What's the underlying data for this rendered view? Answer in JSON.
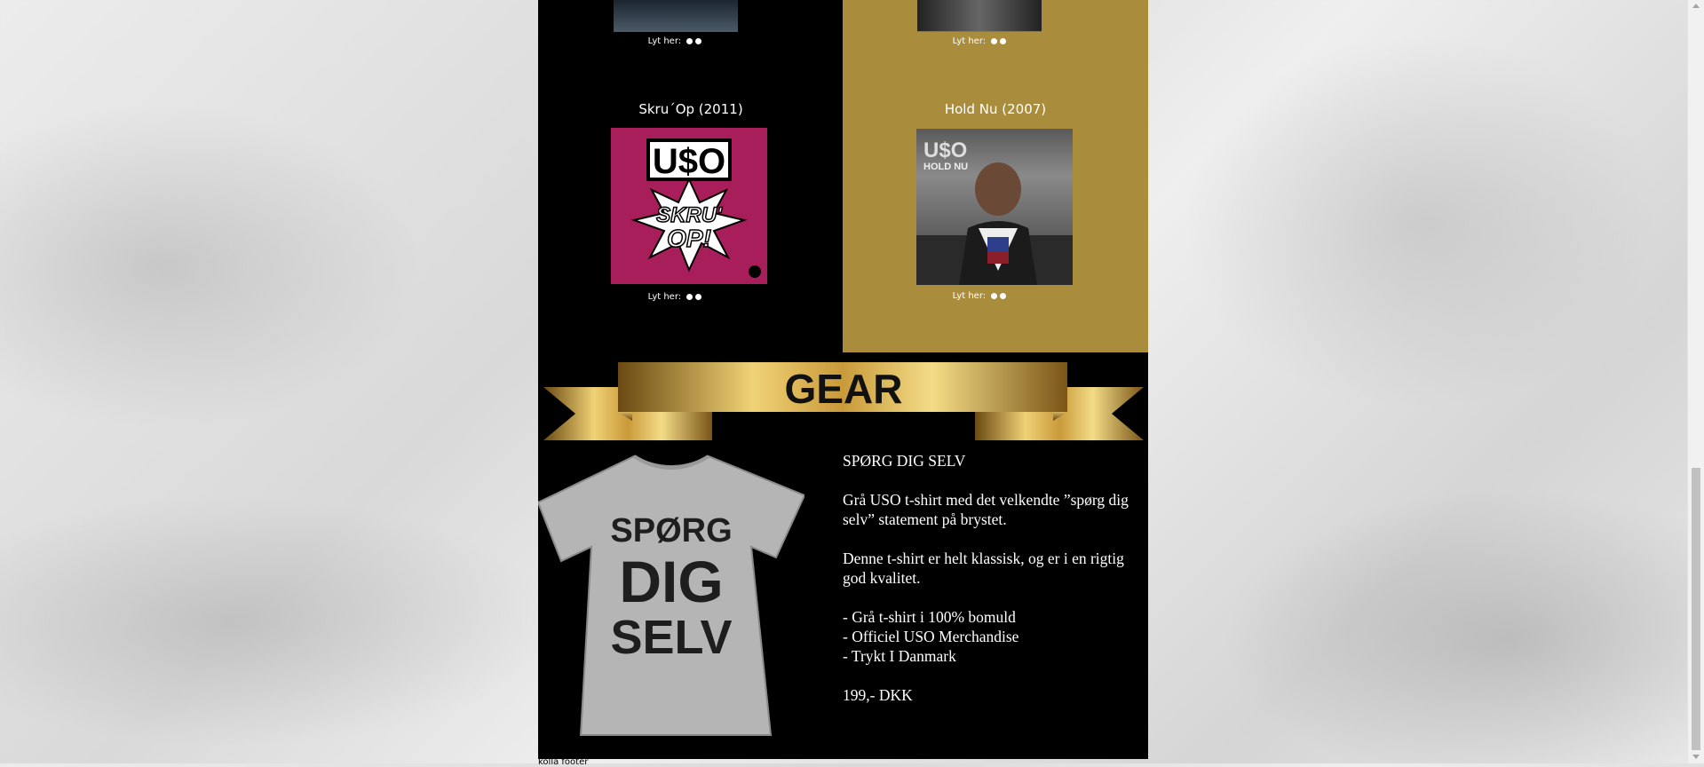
{
  "albums": [
    {
      "title": "Skru´Op (2011)",
      "listen_label": "Lyt her:",
      "cover_text_top": "U$O",
      "cover_text_main": "SKRU' OP!",
      "cover_bg": "#a81e5b"
    },
    {
      "title": "Hold Nu (2007)",
      "listen_label": "Lyt her:",
      "cover_text_top": "U$O",
      "cover_text_sub": "HOLD NU",
      "cover_bg": "#3c3c3c"
    }
  ],
  "top_listen_labels": [
    "Lyt her:",
    "Lyt her:"
  ],
  "gear": {
    "banner_title": "GEAR",
    "shirt_text": [
      "SPØRG",
      "DIG",
      "SELV"
    ],
    "product_name": "SPØRG DIG SELV",
    "description_1": "Grå USO t-shirt med det velkendte ”spørg dig selv” statement på brystet.",
    "description_2": "Denne t-shirt er helt klassisk, og er i en rigtig god kvalitet.",
    "features": [
      "- Grå t-shirt i 100% bomuld",
      "- Officiel USO Merchandise",
      "- Trykt I Danmark"
    ],
    "price": "199,- DKK"
  },
  "footer_partial": "kolla footer",
  "colors": {
    "gold_panel": "#a98c3c",
    "page_bg": "#000000",
    "banner_gold": "#d8b35a"
  },
  "icons": [
    "apple-icon",
    "spotify-icon",
    "scroll-up-icon",
    "scroll-down-icon"
  ]
}
